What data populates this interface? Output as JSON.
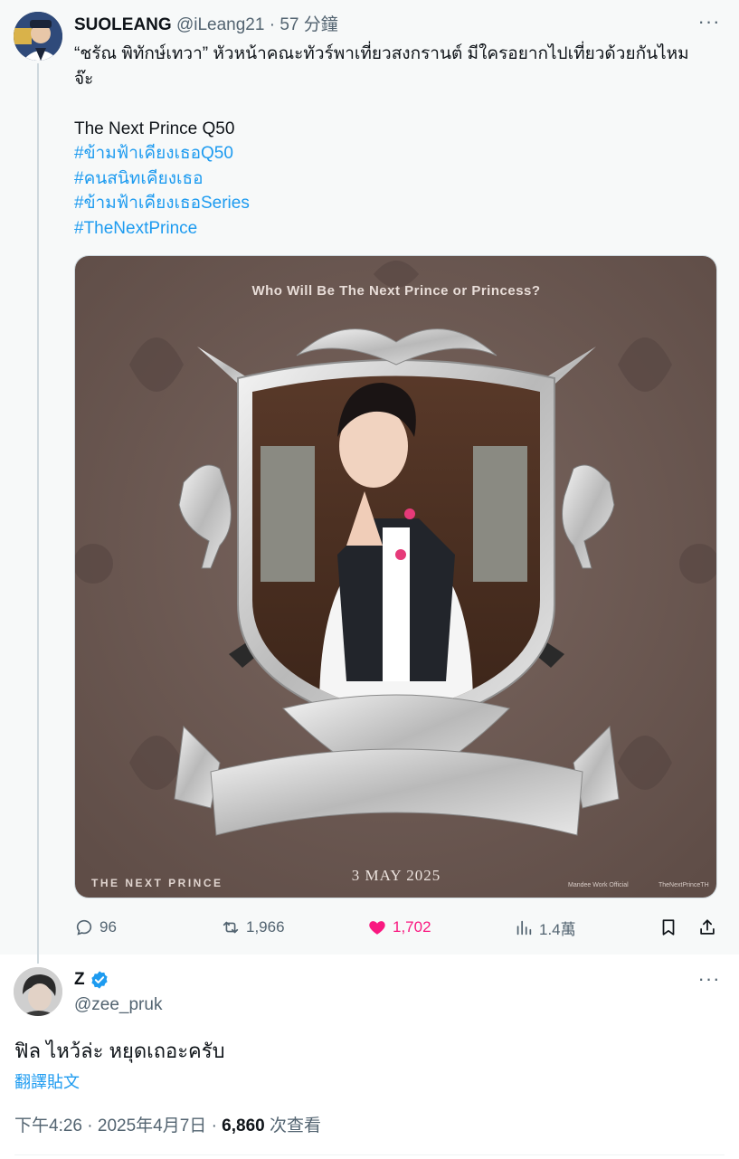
{
  "parent_tweet": {
    "display_name": "SUOLEANG",
    "handle": "@iLeang21",
    "separator": "·",
    "time": "57 分鐘",
    "more": "···",
    "text_line_1": "“ชรัณ พิทักษ์เทวา” หัวหน้าคณะทัวร์พาเที่ยวสงกรานต์ มีใครอยากไปเที่ยวด้วยกันไหม",
    "text_line_2": "จ๊ะ",
    "text_line_3": "The Next Prince Q50",
    "hashtags": [
      "#ข้ามฟ้าเคียงเธอQ50",
      "#คนสนิทเคียงเธอ",
      "#ข้ามฟ้าเคียงเธอSeries",
      "#TheNextPrince"
    ],
    "media": {
      "headline": "Who Will Be The Next Prince or Princess?",
      "brand": "THE NEXT PRINCE",
      "date": "3 MAY 2025",
      "footer_credit": "Mandee Work Official",
      "footer_handle": "TheNextPrinceTH",
      "background_color": "#6e5a53"
    },
    "actions": {
      "replies": "96",
      "reposts": "1,966",
      "likes": "1,702",
      "views": "1.4萬"
    }
  },
  "reply_tweet": {
    "display_name": "Z",
    "handle": "@zee_pruk",
    "more": "···",
    "text": "ฟิล ไหว้ล่ะ หยุดเถอะครับ",
    "translate_link": "翻譯貼文",
    "time": "下午4:26",
    "separator": "·",
    "date": "2025年4月7日",
    "view_count": "6,860",
    "views_label": "次查看"
  },
  "colors": {
    "accent": "#1d9bf0",
    "like": "#f91880",
    "muted": "#536471",
    "text": "#0f1419"
  }
}
